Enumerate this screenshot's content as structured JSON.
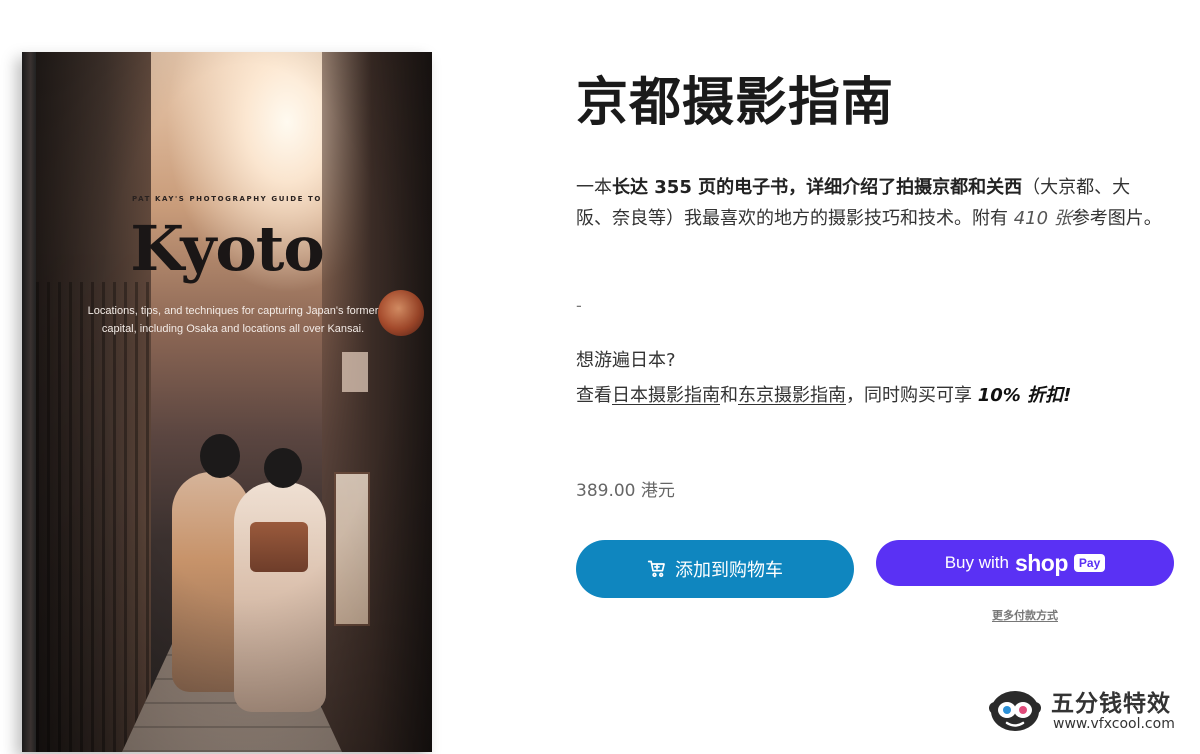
{
  "book": {
    "eyebrow": "PAT KAY'S PHOTOGRAPHY GUIDE TO",
    "title": "Kyoto",
    "subtitle": "Locations, tips, and techniques for capturing Japan's former capital, including Osaka and locations all over Kansai."
  },
  "product": {
    "title": "京都摄影指南",
    "desc_intro": "一本",
    "desc_bold": "长达 355 页的电子书，详细介绍了拍摄京都和关西",
    "desc_mid": "（大京都、大阪、奈良等）我最喜欢的地方的摄影技巧和技术。附有 ",
    "desc_italic": "410 张",
    "desc_end": "参考图片。",
    "separator": "-",
    "promo_question": "想游遍日本?",
    "promo_prefix": "查看",
    "promo_link_1": "日本摄影指南",
    "promo_and": "和",
    "promo_link_2": "东京摄影指南",
    "promo_suffix": "，同时购买可享 ",
    "promo_discount": "10% 折扣!",
    "price": "389.00 港元"
  },
  "actions": {
    "add_to_cart": "添加到购物车",
    "buy_with": "Buy with",
    "shop_word": "shop",
    "pay_badge": "Pay",
    "more_payment": "更多付款方式"
  },
  "watermark": {
    "name": "五分钱特效",
    "url": "www.vfxcool.com"
  },
  "colors": {
    "cart_button": "#0f86bf",
    "shop_button": "#5a31f4"
  }
}
